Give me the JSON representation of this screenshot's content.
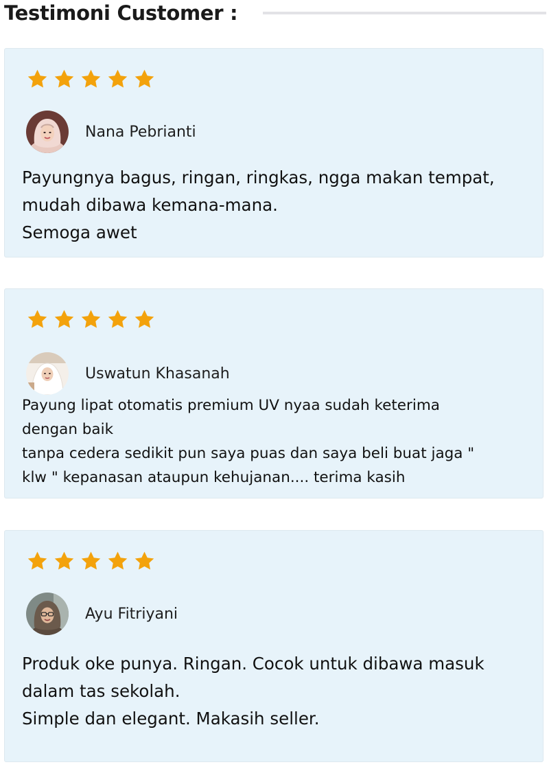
{
  "header": {
    "title": "Testimoni Customer :"
  },
  "colors": {
    "card_background": "#e7f3fa",
    "star": "#f3a20c",
    "divider": "#e2e2e6"
  },
  "testimonials": [
    {
      "rating": 5,
      "avatar_icon": "woman-hijab-avatar-icon",
      "name": "Nana Pebrianti",
      "text": "Payungnya bagus, ringan, ringkas, ngga makan tempat,\nmudah dibawa kemana-mana.\nSemoga awet"
    },
    {
      "rating": 5,
      "avatar_icon": "woman-white-hijab-avatar-icon",
      "name": "Uswatun Khasanah",
      "text": "Payung lipat otomatis premium UV nyaa sudah keterima\ndengan baik\ntanpa cedera sedikit pun saya puas dan saya beli buat jaga \"\nklw \"  kepanasan ataupun kehujanan.... terima kasih"
    },
    {
      "rating": 5,
      "avatar_icon": "woman-glasses-avatar-icon",
      "name": "Ayu Fitriyani",
      "text": "Produk oke punya. Ringan. Cocok untuk dibawa masuk\ndalam tas sekolah.\nSimple dan elegant. Makasih seller."
    }
  ]
}
